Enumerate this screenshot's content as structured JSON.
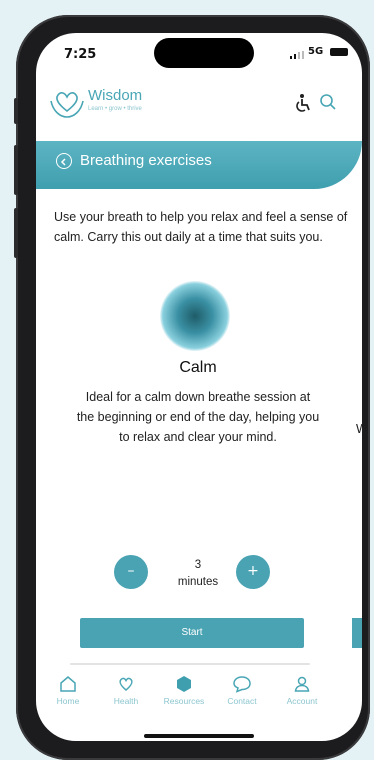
{
  "status_bar": {
    "time": "7:25",
    "network": "5G"
  },
  "header": {
    "app_name": "Wisdom",
    "tagline": "Learn • grow • thrive"
  },
  "banner": {
    "title": "Breathing exercises"
  },
  "intro": {
    "text": "Use your breath to help you relax and feel a sense of calm. Carry this out daily at a time that suits you."
  },
  "exercise": {
    "title": "Calm",
    "description": "Ideal for a calm down breathe session at the beginning or end of the day, helping you to relax and clear your mind.",
    "duration_value": "3",
    "duration_unit": "minutes",
    "decrease_symbol": "–",
    "increase_symbol": "+",
    "start_label": "Start"
  },
  "next_card_peek": {
    "text": "W"
  },
  "nav": {
    "items": [
      {
        "label": "Home",
        "icon": "home-icon"
      },
      {
        "label": "Health",
        "icon": "heart-icon"
      },
      {
        "label": "Resources",
        "icon": "resources-icon"
      },
      {
        "label": "Contact",
        "icon": "chat-icon"
      },
      {
        "label": "Account",
        "icon": "person-icon"
      }
    ]
  },
  "colors": {
    "accent": "#4aa3b3",
    "nav_label": "#8cc6cf",
    "background": "#e4f1f5"
  }
}
